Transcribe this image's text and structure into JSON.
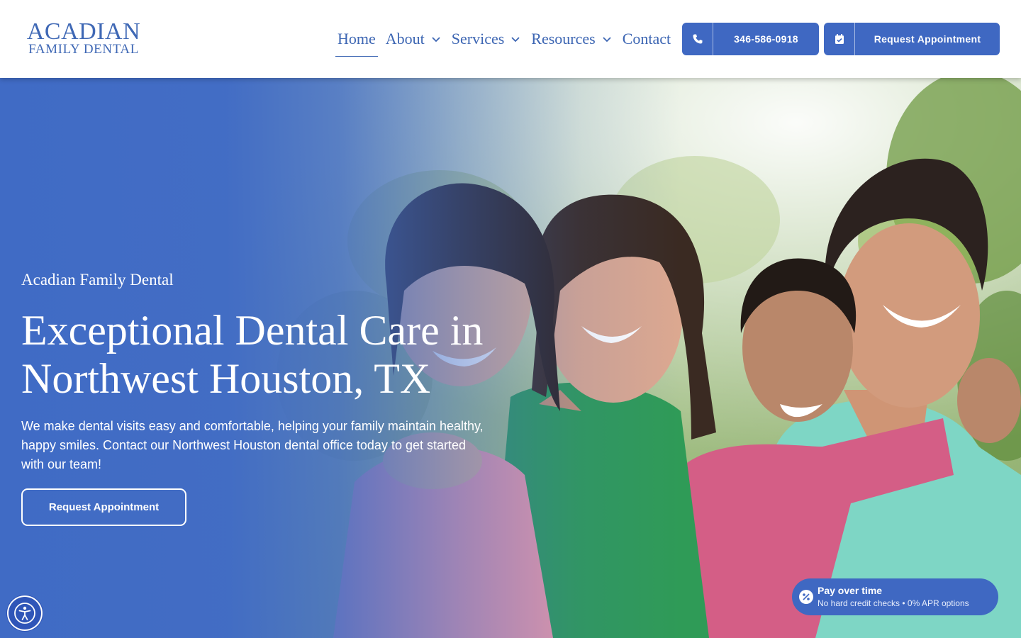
{
  "brand": {
    "name_line1": "ACADIAN",
    "name_line2": "FAMILY DENTAL",
    "color": "#3f68b5"
  },
  "nav": {
    "items": [
      {
        "label": "Home",
        "icon": "",
        "active": true
      },
      {
        "label": "About",
        "icon": "chevron-down-icon"
      },
      {
        "label": "Services",
        "icon": "chevron-down-icon"
      },
      {
        "label": "Resources",
        "icon": "chevron-down-icon"
      },
      {
        "label": "Contact",
        "icon": ""
      }
    ]
  },
  "header_buttons": {
    "phone": {
      "label": "346-586-0918",
      "icon": "phone-icon"
    },
    "appointment": {
      "label": "Request Appointment",
      "icon": "calendar-icon"
    }
  },
  "hero": {
    "eyebrow": "Acadian Family Dental",
    "title": "Exceptional Dental Care in Northwest Houston, TX",
    "text": "We make dental visits easy and comfortable, helping your family maintain healthy, happy smiles. Contact our Northwest Houston dental office today to get started with our team!",
    "cta": "Request Appointment",
    "image_icon": "family-photo",
    "overlay_color": "#406bc5"
  },
  "financing": {
    "title": "Pay over time",
    "subtitle": "No hard credit checks • 0% APR options",
    "icon": "percent-icon"
  },
  "accessibility": {
    "icon": "accessibility-icon"
  },
  "colors": {
    "accent": "#3f68c2",
    "white": "#ffffff"
  }
}
